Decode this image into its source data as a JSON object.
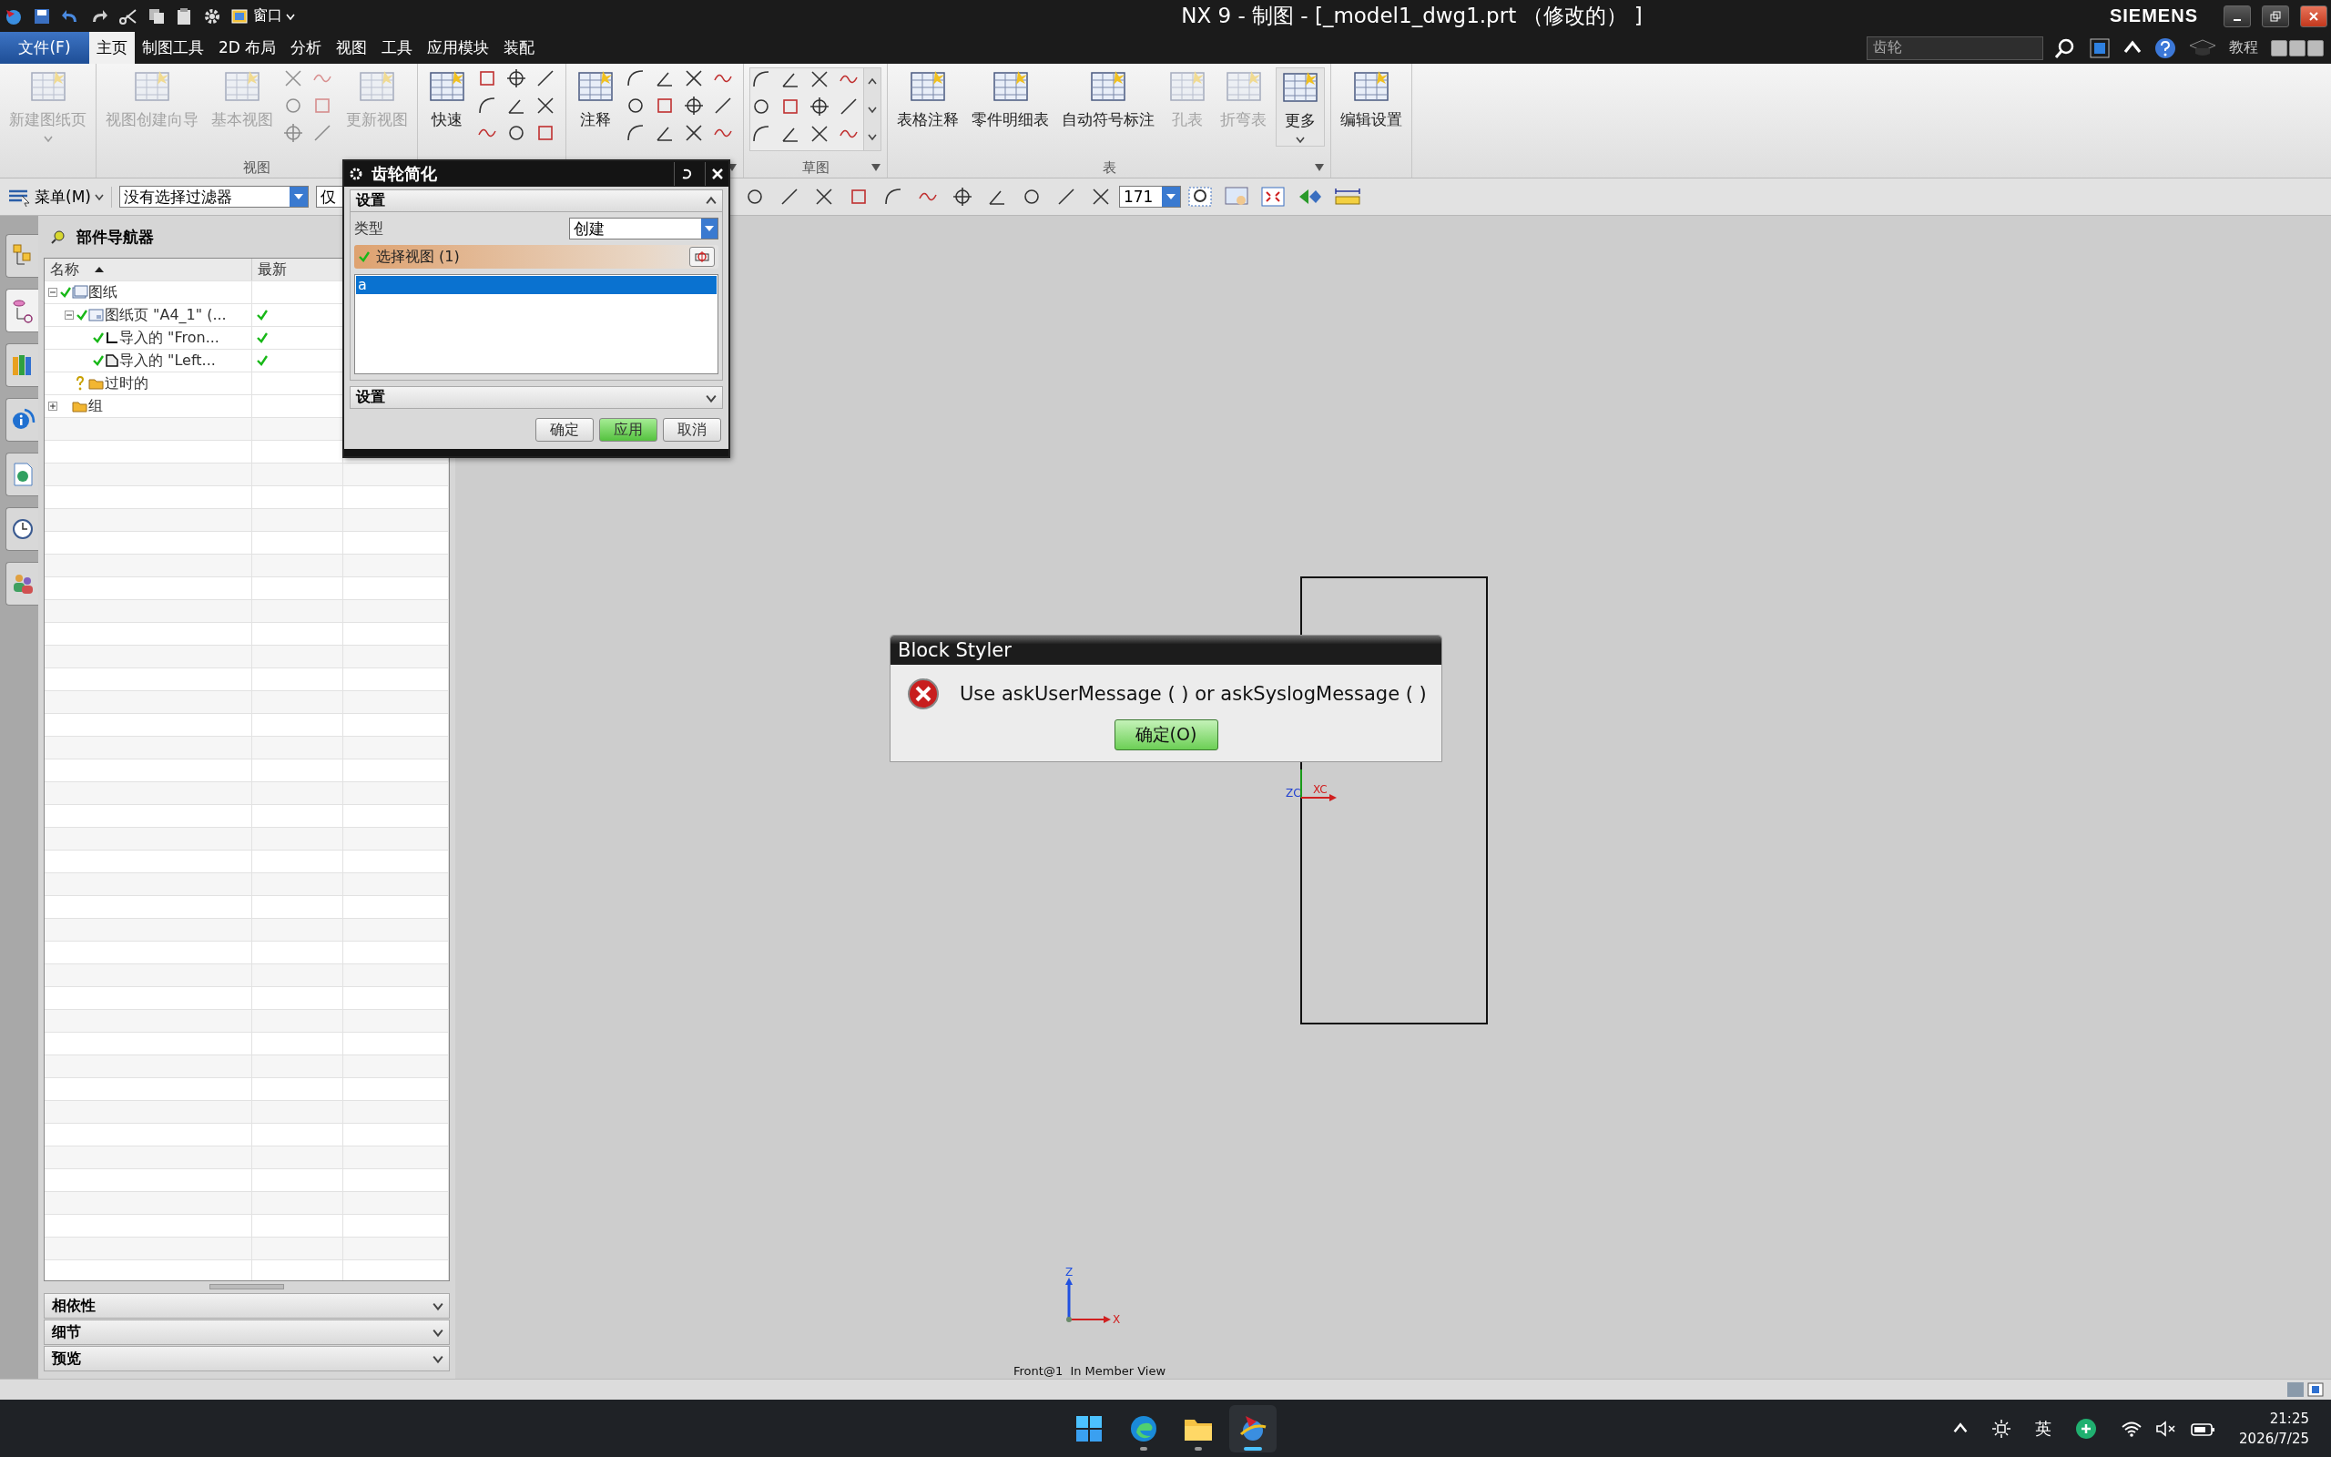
{
  "quick_access": {
    "window_menu": "窗口"
  },
  "title_bar": {
    "title": "NX 9 - 制图 - [_model1_dwg1.prt （修改的） ]",
    "brand": "SIEMENS"
  },
  "menu_tabs": [
    {
      "label": "文件(F)",
      "kind": "file",
      "selected": false
    },
    {
      "label": "主页",
      "kind": "tab",
      "selected": true
    },
    {
      "label": "制图工具",
      "kind": "tab",
      "selected": false
    },
    {
      "label": "2D 布局",
      "kind": "tab",
      "selected": false
    },
    {
      "label": "分析",
      "kind": "tab",
      "selected": false
    },
    {
      "label": "视图",
      "kind": "tab",
      "selected": false
    },
    {
      "label": "工具",
      "kind": "tab",
      "selected": false
    },
    {
      "label": "应用模块",
      "kind": "tab",
      "selected": false
    },
    {
      "label": "装配",
      "kind": "tab",
      "selected": false
    }
  ],
  "search": {
    "value": "齿轮"
  },
  "help": {
    "label": "教程"
  },
  "ribbon": [
    {
      "launcher": false,
      "items": [
        {
          "kind": "large",
          "label": "新建图纸页",
          "disabled": true,
          "dropdown": true
        }
      ]
    },
    {
      "label": "视图",
      "launcher": false,
      "items": [
        {
          "kind": "large",
          "label": "视图创建向导",
          "disabled": true,
          "dropdown": false
        },
        {
          "kind": "large",
          "label": "基本视图",
          "disabled": true,
          "dropdown": false
        },
        {
          "kind": "narrow",
          "disabled": true
        },
        {
          "kind": "large",
          "label": "更新视图",
          "disabled": true,
          "dropdown": false
        }
      ]
    },
    {
      "items": [
        {
          "kind": "large",
          "label": "快速",
          "disabled": false,
          "dropdown": false
        },
        {
          "kind": "grid",
          "disabled": false
        }
      ]
    },
    {
      "launcher": true,
      "items": [
        {
          "kind": "large",
          "label": "注释",
          "disabled": false,
          "dropdown": false
        },
        {
          "kind": "wide",
          "disabled": false
        }
      ]
    },
    {
      "label": "草图",
      "launcher": true,
      "items": [
        {
          "kind": "gallery",
          "disabled": false
        }
      ]
    },
    {
      "label": "表",
      "launcher": true,
      "items": [
        {
          "kind": "large",
          "label": "表格注释",
          "disabled": false,
          "dropdown": false
        },
        {
          "kind": "large",
          "label": "零件明细表",
          "disabled": false,
          "dropdown": false
        },
        {
          "kind": "large",
          "label": "自动符号标注",
          "disabled": false,
          "dropdown": false
        },
        {
          "kind": "large",
          "label": "孔表",
          "disabled": true,
          "dropdown": false
        },
        {
          "kind": "large",
          "label": "折弯表",
          "disabled": true,
          "dropdown": false
        },
        {
          "kind": "more",
          "label": "更多",
          "disabled": false,
          "dropdown": true
        }
      ]
    },
    {
      "launcher": false,
      "items": [
        {
          "kind": "large",
          "label": "编辑设置",
          "disabled": false,
          "dropdown": false
        }
      ]
    }
  ],
  "toolbar": {
    "menu_button": "菜单(M)",
    "filter": {
      "value": "没有选择过滤器"
    },
    "scope": {
      "value": "仅"
    },
    "scale": {
      "value": "171"
    }
  },
  "resource_bar": [
    {
      "kind": "assembly",
      "selected": false
    },
    {
      "kind": "part",
      "selected": true
    },
    {
      "kind": "library",
      "selected": false
    },
    {
      "kind": "info",
      "selected": false
    },
    {
      "kind": "web",
      "selected": false
    },
    {
      "kind": "history",
      "selected": false
    },
    {
      "kind": "roles",
      "selected": false
    }
  ],
  "navigator": {
    "title": "部件导航器",
    "columns": [
      {
        "label": "名称",
        "sorted": true
      },
      {
        "label": "最新",
        "sorted": false
      }
    ],
    "tree": [
      {
        "label": "图纸",
        "kind": "drawing",
        "current": true,
        "outdated": false,
        "latest": false,
        "expanded": true,
        "children": [
          {
            "label": "图纸页 \"A4_1\" (...",
            "kind": "sheet",
            "current": true,
            "outdated": false,
            "latest": true,
            "expanded": true,
            "children": [
              {
                "label": "导入的 \"Fron...",
                "kind": "front",
                "current": true,
                "outdated": false,
                "latest": true
              },
              {
                "label": "导入的 \"Left...",
                "kind": "left",
                "current": true,
                "outdated": false,
                "latest": true
              }
            ]
          },
          {
            "label": "过时的",
            "kind": "folder",
            "current": false,
            "outdated": true,
            "latest": false
          }
        ]
      },
      {
        "label": "组",
        "kind": "folder",
        "current": false,
        "outdated": false,
        "latest": false,
        "expanded": false
      }
    ]
  },
  "panels": [
    {
      "label": "相依性",
      "expanded": false
    },
    {
      "label": "细节",
      "expanded": false
    },
    {
      "label": "预览",
      "expanded": false
    }
  ],
  "gear_dialog": {
    "title": "齿轮简化",
    "section": {
      "title": "设置",
      "expanded": true
    },
    "type_label": "类型",
    "type_value": "创建",
    "selection": {
      "label": "选择视图 (1)",
      "complete": true
    },
    "list": [
      {
        "label": "a",
        "selected": true
      }
    ],
    "settings": {
      "title": "设置",
      "expanded": false
    },
    "buttons": [
      {
        "label": "确定",
        "default": false
      },
      {
        "label": "应用",
        "default": true
      },
      {
        "label": "取消",
        "default": false
      }
    ]
  },
  "message_box": {
    "title": "Block Styler",
    "kind": "error",
    "message": "Use askUserMessage ( ) or askSyslogMessage ( )",
    "button": "确定(O)"
  },
  "canvas": {
    "view_label": "Front@1  In Member View",
    "wcs": {
      "x": "XC",
      "z": "ZC"
    },
    "triad": {
      "x": "X",
      "z": "Z"
    }
  },
  "taskbar": {
    "apps": [
      {
        "kind": "start",
        "running": false,
        "selected": false
      },
      {
        "kind": "browser",
        "running": true,
        "selected": false
      },
      {
        "kind": "files",
        "running": true,
        "selected": false
      },
      {
        "kind": "nx",
        "running": true,
        "selected": true
      }
    ],
    "ime": "英",
    "time": "21:25",
    "date": "2026/7/25"
  }
}
